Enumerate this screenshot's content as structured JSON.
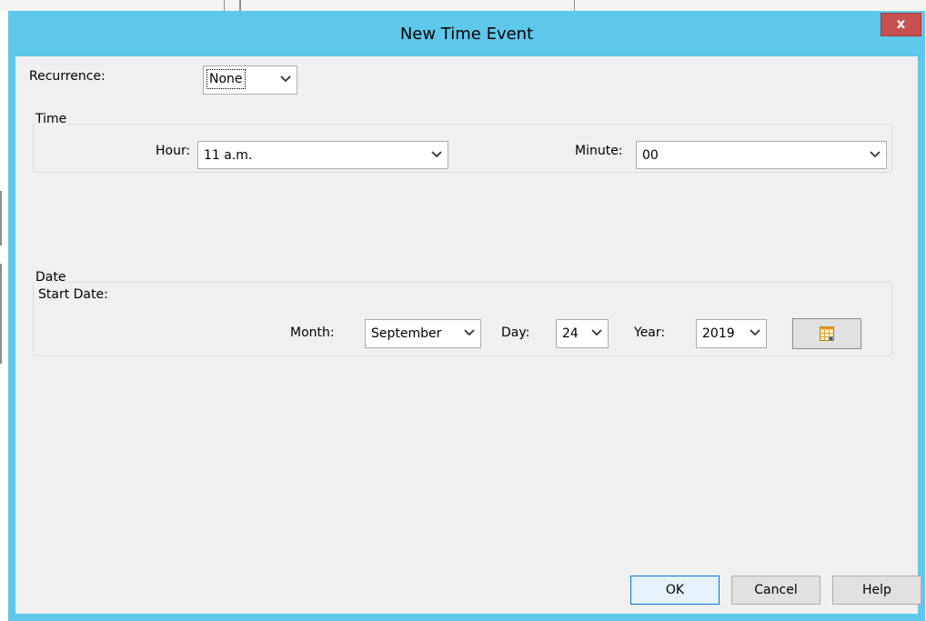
{
  "dialog": {
    "title": "New Time Event",
    "close_label": "x"
  },
  "recurrence": {
    "label": "Recurrence:",
    "value": "None"
  },
  "time_group": {
    "title": "Time",
    "hour_label": "Hour:",
    "hour_value": "11 a.m.",
    "minute_label": "Minute:",
    "minute_value": "00"
  },
  "date_group": {
    "title": "Date",
    "start_date_label": "Start Date:",
    "month_label": "Month:",
    "month_value": "September",
    "day_label": "Day:",
    "day_value": "24",
    "year_label": "Year:",
    "year_value": "2019",
    "calendar_icon": "calendar-icon"
  },
  "buttons": {
    "ok": "OK",
    "cancel": "Cancel",
    "help": "Help"
  },
  "colors": {
    "titlebar": "#5ec8ea",
    "close": "#c75050",
    "dialog_bg": "#f0f0f0",
    "default_button_border": "#0078d7"
  }
}
